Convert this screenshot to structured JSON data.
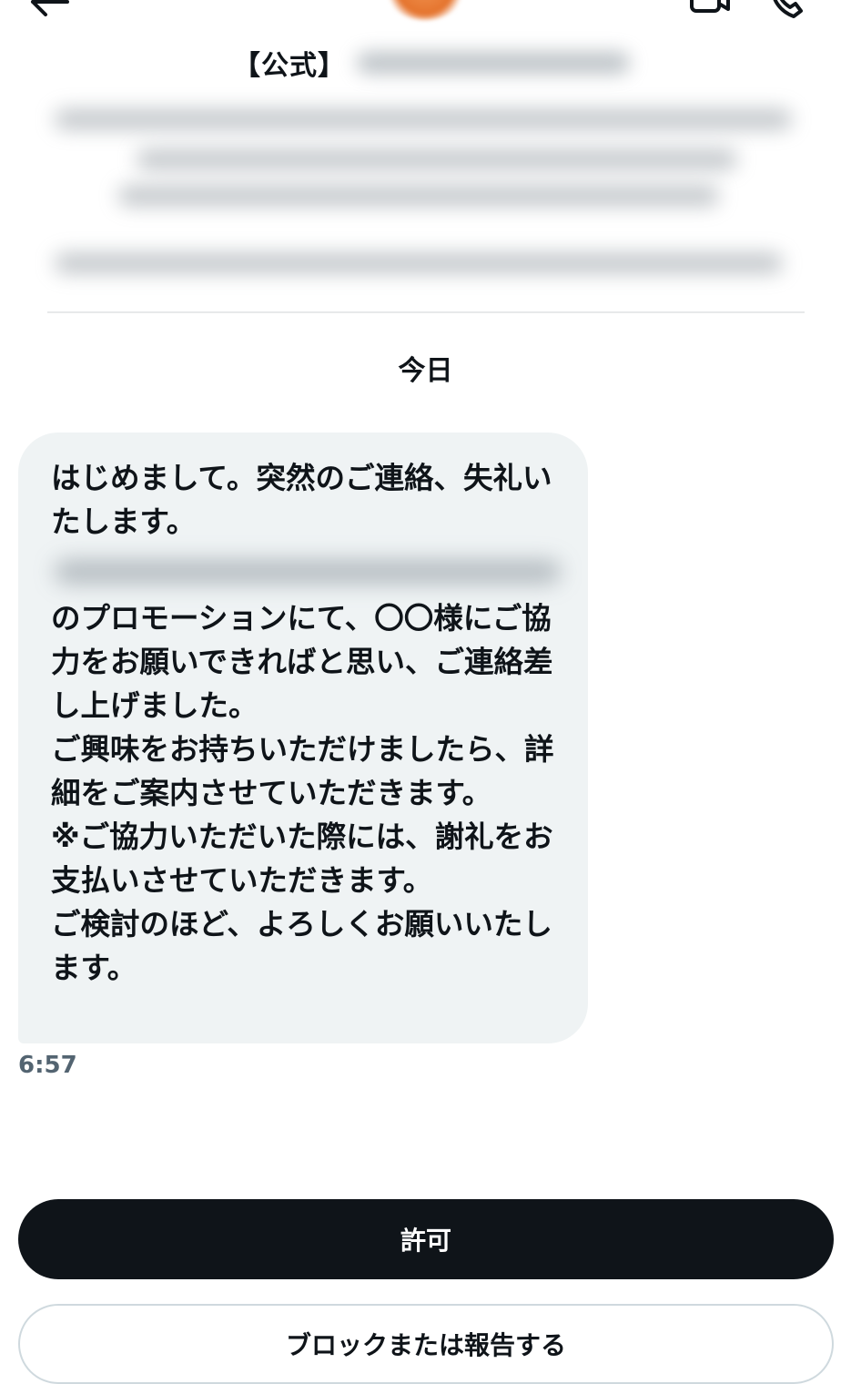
{
  "header": {
    "back_icon": "back-arrow-icon",
    "video_icon": "video-icon",
    "call_icon": "phone-call-icon",
    "account_prefix": "【公式】"
  },
  "conversation": {
    "date_separator": "今日",
    "message": {
      "part1": "はじめまして。突然のご連絡、失礼いたします。",
      "part2": "のプロモーションにて、〇〇様にご協力をお願いできればと思い、ご連絡差し上げました。\nご興味をお持ちいただけましたら、詳細をご案内させていただきます。\n※ご協力いただいた際には、謝礼をお支払いさせていただきます。\nご検討のほど、よろしくお願いいたします。",
      "time": "6:57"
    }
  },
  "actions": {
    "allow_label": "許可",
    "block_label": "ブロックまたは報告する"
  },
  "colors": {
    "bubble_bg": "#eff3f4",
    "primary_button": "#0f1419",
    "muted_text": "#536471"
  }
}
